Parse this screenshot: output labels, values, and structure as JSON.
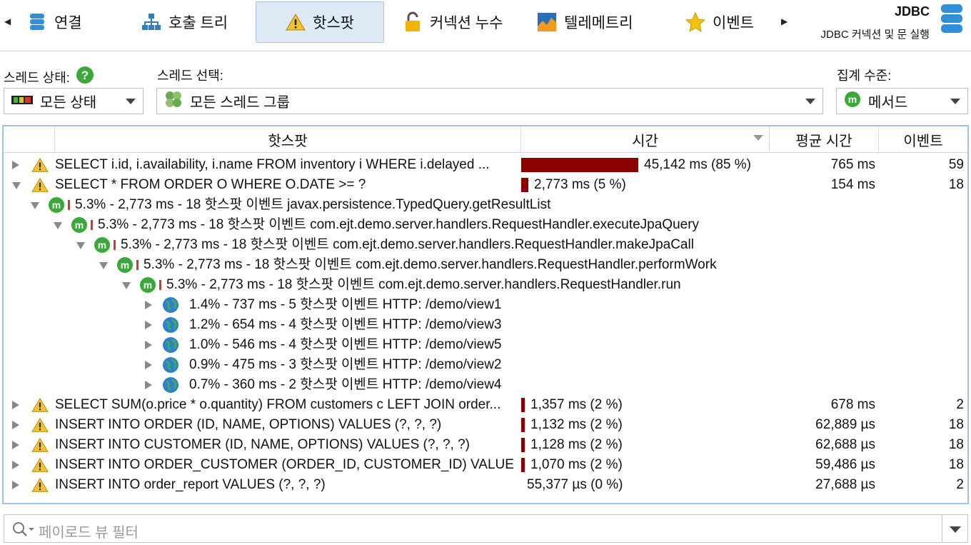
{
  "toolbar": {
    "tabs": [
      {
        "label": "연결",
        "icon": "database-icon"
      },
      {
        "label": "호출 트리",
        "icon": "tree-icon"
      },
      {
        "label": "핫스팟",
        "icon": "warning-icon"
      },
      {
        "label": "커넥션 누수",
        "icon": "lock-icon"
      },
      {
        "label": "텔레메트리",
        "icon": "telemetry-icon"
      },
      {
        "label": "이벤트",
        "icon": "star-icon"
      }
    ],
    "title": "JDBC",
    "subtitle": "JDBC 커넥션 및 문 실행"
  },
  "filters": {
    "thread_state_label": "스레드 상태:",
    "thread_state_value": "모든 상태",
    "thread_select_label": "스레드 선택:",
    "thread_select_value": "모든 스레드 그룹",
    "aggregation_label": "집계 수준:",
    "aggregation_value": "메서드"
  },
  "table": {
    "columns": [
      "핫스팟",
      "시간",
      "평균 시간",
      "이벤트"
    ],
    "rows": [
      {
        "label": "SELECT i.id, i.availability, i.name FROM inventory i WHERE i.delayed ...",
        "time": "45,142 ms (85 %)",
        "pct": 0.85,
        "avg": "765 ms",
        "events": "59",
        "expanded": false
      },
      {
        "label": "SELECT * FROM ORDER O WHERE O.DATE >= ?",
        "time": "2,773 ms (5 %)",
        "pct": 0.05,
        "avg": "154 ms",
        "events": "18",
        "expanded": true
      },
      {
        "label": "5.3% - 2,773 ms - 18 핫스팟 이벤트 javax.persistence.TypedQuery.getResultList"
      },
      {
        "label": "5.3% - 2,773 ms - 18 핫스팟 이벤트 com.ejt.demo.server.handlers.RequestHandler.executeJpaQuery"
      },
      {
        "label": "5.3% - 2,773 ms - 18 핫스팟 이벤트 com.ejt.demo.server.handlers.RequestHandler.makeJpaCall"
      },
      {
        "label": "5.3% - 2,773 ms - 18 핫스팟 이벤트 com.ejt.demo.server.handlers.RequestHandler.performWork"
      },
      {
        "label": "5.3% - 2,773 ms - 18 핫스팟 이벤트 com.ejt.demo.server.handlers.RequestHandler.run"
      },
      {
        "label": "1.4% - 737 ms - 5 핫스팟 이벤트 HTTP: /demo/view1"
      },
      {
        "label": "1.2% - 654 ms - 4 핫스팟 이벤트 HTTP: /demo/view3"
      },
      {
        "label": "1.0% - 546 ms - 4 핫스팟 이벤트 HTTP: /demo/view5"
      },
      {
        "label": "0.9% - 475 ms - 3 핫스팟 이벤트 HTTP: /demo/view2"
      },
      {
        "label": "0.7% - 360 ms - 2 핫스팟 이벤트 HTTP: /demo/view4"
      },
      {
        "label": "SELECT SUM(o.price * o.quantity) FROM customers c LEFT JOIN order...",
        "time": "1,357 ms (2 %)",
        "pct": 0.02,
        "avg": "678 ms",
        "events": "2"
      },
      {
        "label": "INSERT INTO ORDER (ID, NAME, OPTIONS) VALUES (?, ?, ?)",
        "time": "1,132 ms (2 %)",
        "pct": 0.02,
        "avg": "62,889 µs",
        "events": "18"
      },
      {
        "label": "INSERT INTO CUSTOMER (ID, NAME, OPTIONS) VALUES (?, ?, ?)",
        "time": "1,128 ms (2 %)",
        "pct": 0.02,
        "avg": "62,688 µs",
        "events": "18"
      },
      {
        "label": "INSERT INTO ORDER_CUSTOMER (ORDER_ID, CUSTOMER_ID) VALUE",
        "time": "1,070 ms (2 %)",
        "pct": 0.02,
        "avg": "59,486 µs",
        "events": "18"
      },
      {
        "label": "INSERT INTO order_report VALUES (?, ?, ?)",
        "time": "55,377 µs (0 %)",
        "pct": 0.0,
        "avg": "27,688 µs",
        "events": "2"
      }
    ]
  },
  "bottom_filter": {
    "placeholder": "페이로드 뷰 필터"
  }
}
